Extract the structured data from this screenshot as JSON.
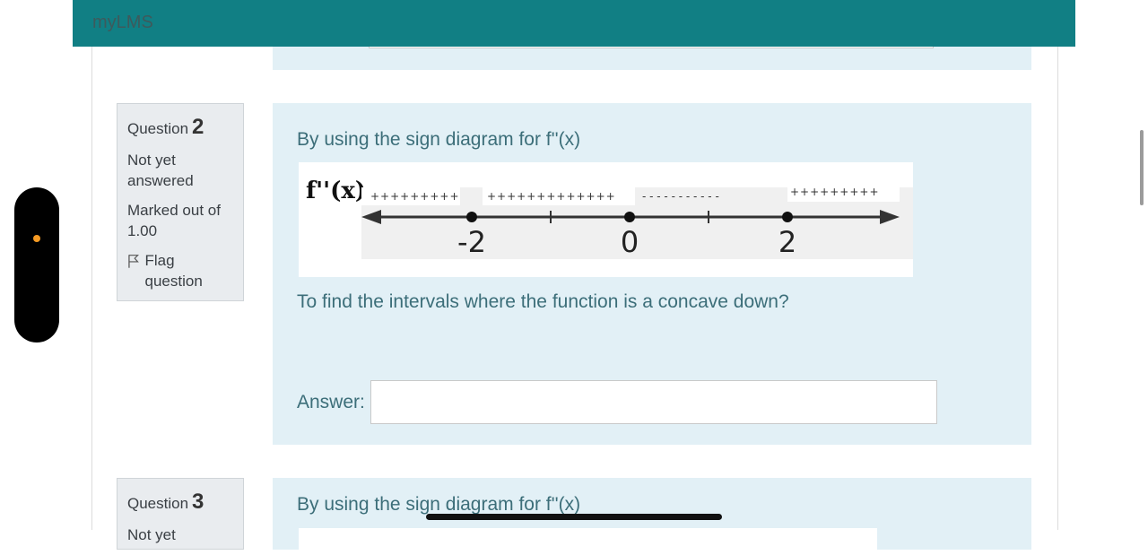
{
  "app": {
    "title": "myLMS"
  },
  "questions": [
    {
      "label": "Question",
      "number": "2",
      "state": "Not yet answered",
      "grade": "Marked out of 1.00",
      "flag_label": "Flag question",
      "text": "By using  the sign diagram for f''(x)",
      "prompt": "To find the intervals where the function is a concave down?",
      "answer_label": "Answer:",
      "answer_value": "",
      "diagram": {
        "function_label": "f''(x)",
        "ticks": [
          "-2",
          "0",
          "2"
        ],
        "signs": [
          "+++++++++",
          "+++++++++++++",
          "- - - - - - - - - - -",
          "+++++++++"
        ]
      }
    },
    {
      "label": "Question",
      "number": "3",
      "state": "Not yet",
      "text": "By using  the sign diagram for f''(x)"
    }
  ],
  "colors": {
    "header": "#117f84",
    "formulation_bg": "#e2f0f6",
    "info_bg": "#e9ecef",
    "text_teal": "#3c6e79",
    "side_dot": "#f59a23"
  }
}
